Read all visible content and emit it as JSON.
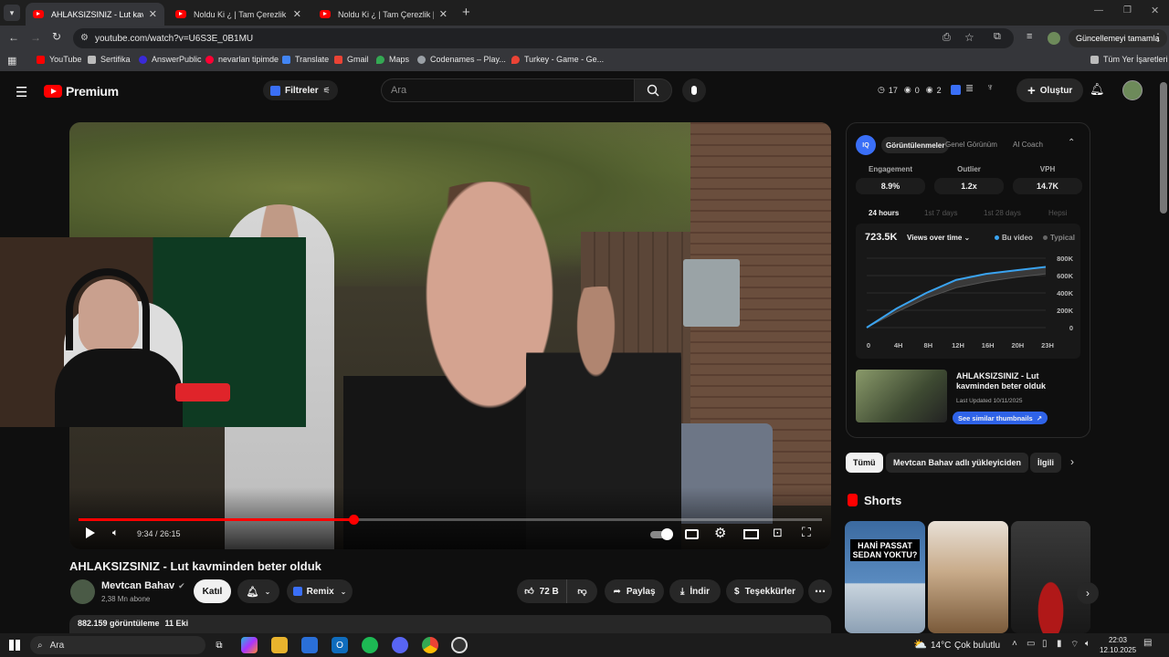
{
  "browser": {
    "tabs": [
      {
        "title": "AHLAKSIZSINIZ - Lut kavminden",
        "active": true
      },
      {
        "title": "Noldu Ki ¿ | Tam Çerezlik | #247",
        "active": false
      },
      {
        "title": "Noldu Ki ¿ | Tam Çerezlik | #248",
        "active": false
      }
    ],
    "url": "youtube.com/watch?v=U6S3E_0B1MU",
    "update_button": "Güncellemeyi tamamla",
    "bookmarks": [
      {
        "label": "YouTube",
        "color": "#ff0000"
      },
      {
        "label": "Sertifika",
        "color": "#bbbbbb"
      },
      {
        "label": "AnswerPublic",
        "color": "#3a2ad8"
      },
      {
        "label": "nevarlan tipimde",
        "color": "#ff0033"
      },
      {
        "label": "Translate",
        "color": "#4285f4"
      },
      {
        "label": "Gmail",
        "color": "#ea4335"
      },
      {
        "label": "Maps",
        "color": "#34a853"
      },
      {
        "label": "Codenames – Play...",
        "color": "#9aa0a6"
      },
      {
        "label": "Turkey - Game - Ge...",
        "color": "#ea4335"
      }
    ],
    "all_bookmarks": "Tüm Yer İşaretleri"
  },
  "yt": {
    "logo": "Premium",
    "filters": "Filtreler",
    "search_placeholder": "Ara",
    "stats": {
      "a": "17",
      "b": "0",
      "c": "2"
    },
    "create": "Oluştur"
  },
  "video": {
    "time": "9:34 / 26:15",
    "progress": 0.37,
    "title": "AHLAKSIZSINIZ - Lut kavminden beter olduk",
    "channel": "Mevtcan Bahav",
    "subscribers": "2,38 Mn abone",
    "join": "Katıl",
    "remix": "Remix",
    "likes": "72 B",
    "share": "Paylaş",
    "download": "İndir",
    "thanks": "Teşekkürler",
    "views": "882.159 görüntüleme",
    "date": "11 Eki"
  },
  "vidiq": {
    "tabs": [
      "Görüntülenmeler",
      "Genel Görünüm",
      "AI Coach"
    ],
    "metrics": [
      {
        "label": "Engagement",
        "value": "8.9%"
      },
      {
        "label": "Outlier",
        "value": "1.2x"
      },
      {
        "label": "VPH",
        "value": "14.7K"
      }
    ],
    "periods": [
      "24 hours",
      "1st 7 days",
      "1st 28 days",
      "Hepsi"
    ],
    "total": "723.5K",
    "dropdown": "Views over time",
    "legend": [
      "Bu video",
      "Typical"
    ],
    "card_title": "AHLAKSIZSINIZ - Lut kavminden beter olduk",
    "card_updated": "Last Updated 10/11/2025",
    "card_button": "See similar thumbnails"
  },
  "chart_data": {
    "type": "area",
    "x": [
      "0",
      "4H",
      "8H",
      "12H",
      "16H",
      "20H",
      "23H"
    ],
    "y_ticks": [
      "800K",
      "600K",
      "400K",
      "200K",
      "0"
    ],
    "ylim": [
      0,
      800000
    ],
    "series": [
      {
        "name": "Bu video",
        "values": [
          0,
          220000,
          400000,
          550000,
          620000,
          660000,
          700000
        ]
      },
      {
        "name": "Typical",
        "values": [
          0,
          180000,
          340000,
          460000,
          530000,
          580000,
          620000
        ]
      }
    ],
    "legend_position": "top-right"
  },
  "chips": [
    "Tümü",
    "Mevtcan Bahav adlı yükleyiciden",
    "İlgili"
  ],
  "shorts": {
    "title": "Shorts",
    "first_caption": "HANİ PASSAT SEDAN YOKTU?"
  },
  "taskbar": {
    "search": "Ara",
    "weather": "14°C",
    "weather_desc": "Çok bulutlu",
    "time": "22:03",
    "date": "12.10.2025"
  }
}
